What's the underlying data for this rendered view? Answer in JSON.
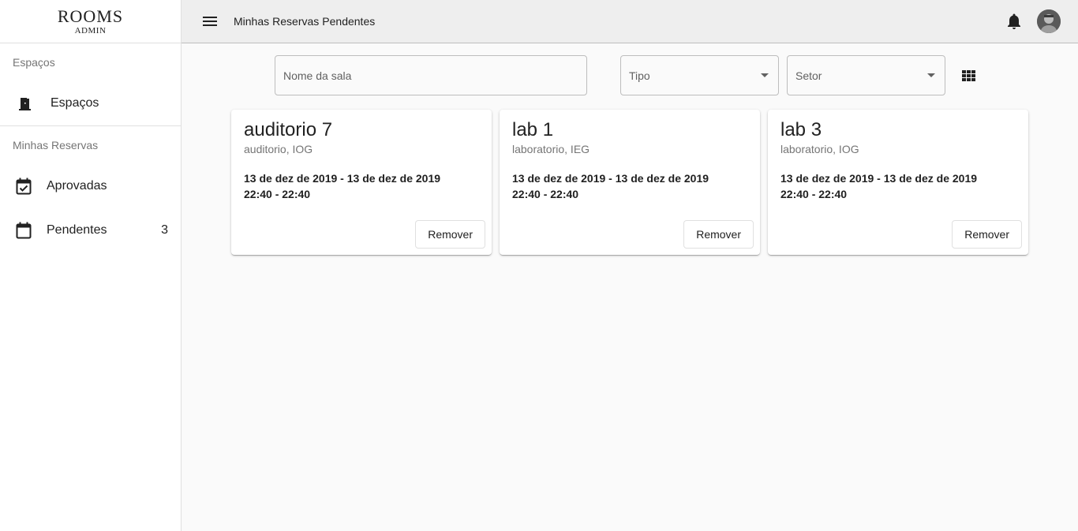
{
  "logo": {
    "title": "ROOMS",
    "subtitle": "ADMIN"
  },
  "sidebar": {
    "section_spaces": "Espaços",
    "spaces_item": {
      "label": "Espaços",
      "icon": "door-icon"
    },
    "section_reservations": "Minhas Reservas",
    "approved_item": {
      "label": "Aprovadas",
      "icon": "calendar-check-icon"
    },
    "pending_item": {
      "label": "Pendentes",
      "icon": "calendar-icon",
      "count": "3"
    }
  },
  "header": {
    "breadcrumb": [
      "Minhas",
      "Reservas",
      "Pendentes"
    ]
  },
  "filters": {
    "name_placeholder": "Nome da sala",
    "type_label": "Tipo",
    "sector_label": "Setor"
  },
  "cards": [
    {
      "title": "auditorio 7",
      "subtitle": "auditorio, IOG",
      "dates": "13 de dez de 2019 - 13 de dez de 2019",
      "times": "22:40 - 22:40",
      "action": "Remover"
    },
    {
      "title": "lab 1",
      "subtitle": "laboratorio, IEG",
      "dates": "13 de dez de 2019 - 13 de dez de 2019",
      "times": "22:40 - 22:40",
      "action": "Remover"
    },
    {
      "title": "lab 3",
      "subtitle": "laboratorio, IOG",
      "dates": "13 de dez de 2019 - 13 de dez de 2019",
      "times": "22:40 - 22:40",
      "action": "Remover"
    }
  ]
}
